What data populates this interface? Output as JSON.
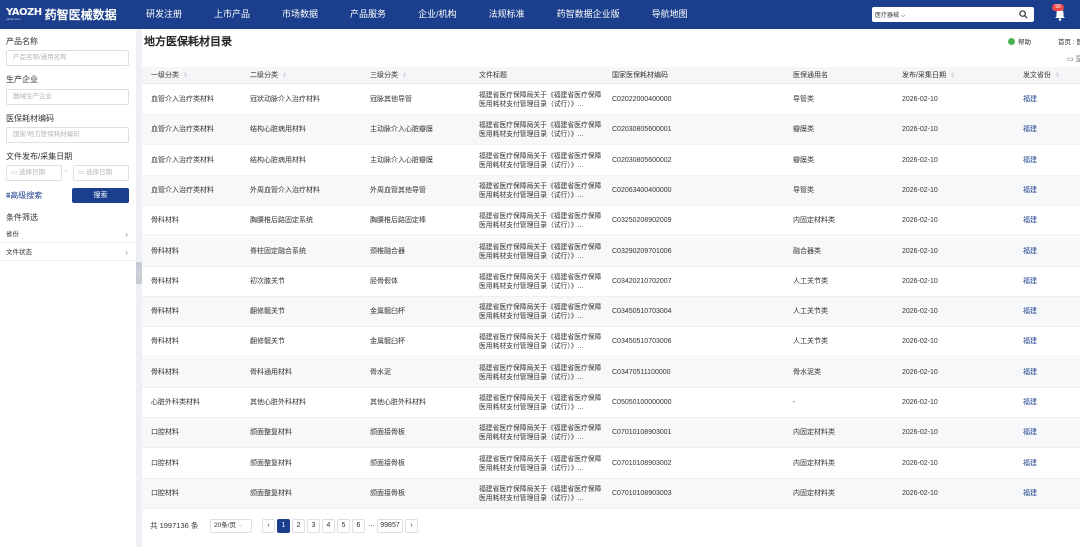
{
  "brand": {
    "logo_mark": "YAOZH",
    "logo_sub": "yaozh.com",
    "name": "药智医械数据"
  },
  "nav": [
    "研发注册",
    "上市产品",
    "市场数据",
    "产品服务",
    "企业/机构",
    "法规标准",
    "药智数据企业版",
    "导航地图"
  ],
  "top_search": {
    "selected": "医疗器械",
    "badge": "99"
  },
  "sidebar": {
    "product_name_label": "产品名称",
    "product_name_placeholder": "产品名称/通用名称",
    "company_label": "生产企业",
    "company_placeholder": "器械生产企业",
    "code_label": "医保耗材编码",
    "code_placeholder": "国家/地方医保耗材编码",
    "date_label": "文件发布/采集日期",
    "date_start_placeholder": "选择日期",
    "date_sep": "-",
    "date_end_placeholder": "选择日期",
    "advanced_search": "高级搜索",
    "search_button": "搜索",
    "filter_title": "条件筛选",
    "filters": [
      "省份",
      "文件状态"
    ]
  },
  "page": {
    "title": "地方医保耗材目录",
    "help": "帮助",
    "breadcrumb": "首页 : 医"
  },
  "table": {
    "columns": [
      "一级分类",
      "二级分类",
      "三级分类",
      "文件标题",
      "国家医保耗材编码",
      "医保通用名",
      "发布/采集日期",
      "发文省份"
    ],
    "rows": [
      {
        "c1": "血管介入治疗类材料",
        "c2": "冠状动脉介入治疗材料",
        "c3": "冠脉其他导管",
        "title": "福建省医疗保障局关于《福建省医疗保障医用耗材支付管理目录（试行）》...",
        "code": "C02022000400000",
        "generic": "导管类",
        "date": "2026-02-10",
        "prov": "福建"
      },
      {
        "c1": "血管介入治疗类材料",
        "c2": "结构心脏病用材料",
        "c3": "主动脉介入心脏瓣膜",
        "title": "福建省医疗保障局关于《福建省医疗保障医用耗材支付管理目录（试行）》...",
        "code": "C02030805600001",
        "generic": "瓣膜类",
        "date": "2026-02-10",
        "prov": "福建"
      },
      {
        "c1": "血管介入治疗类材料",
        "c2": "结构心脏病用材料",
        "c3": "主动脉介入心脏瓣膜",
        "title": "福建省医疗保障局关于《福建省医疗保障医用耗材支付管理目录（试行）》...",
        "code": "C02030805600002",
        "generic": "瓣膜类",
        "date": "2026-02-10",
        "prov": "福建"
      },
      {
        "c1": "血管介入治疗类材料",
        "c2": "外周血管介入治疗材料",
        "c3": "外周血管其他导管",
        "title": "福建省医疗保障局关于《福建省医疗保障医用耗材支付管理目录（试行）》...",
        "code": "C02063400400000",
        "generic": "导管类",
        "date": "2026-02-10",
        "prov": "福建"
      },
      {
        "c1": "骨科材料",
        "c2": "胸腰椎后路固定系统",
        "c3": "胸腰椎后路固定棒",
        "title": "福建省医疗保障局关于《福建省医疗保障医用耗材支付管理目录（试行）》...",
        "code": "C03250208902009",
        "generic": "内固定材料类",
        "date": "2026-02-10",
        "prov": "福建"
      },
      {
        "c1": "骨科材料",
        "c2": "脊柱固定融合系统",
        "c3": "颈椎融合器",
        "title": "福建省医疗保障局关于《福建省医疗保障医用耗材支付管理目录（试行）》...",
        "code": "C03290209701006",
        "generic": "融合器类",
        "date": "2026-02-10",
        "prov": "福建"
      },
      {
        "c1": "骨科材料",
        "c2": "初次膝关节",
        "c3": "胫骨假体",
        "title": "福建省医疗保障局关于《福建省医疗保障医用耗材支付管理目录（试行）》...",
        "code": "C03420210702007",
        "generic": "人工关节类",
        "date": "2026-02-10",
        "prov": "福建"
      },
      {
        "c1": "骨科材料",
        "c2": "翻修髋关节",
        "c3": "金属髋臼杯",
        "title": "福建省医疗保障局关于《福建省医疗保障医用耗材支付管理目录（试行）》...",
        "code": "C03450510703004",
        "generic": "人工关节类",
        "date": "2026-02-10",
        "prov": "福建"
      },
      {
        "c1": "骨科材料",
        "c2": "翻修髋关节",
        "c3": "金属髋臼杯",
        "title": "福建省医疗保障局关于《福建省医疗保障医用耗材支付管理目录（试行）》...",
        "code": "C03450510703006",
        "generic": "人工关节类",
        "date": "2026-02-10",
        "prov": "福建"
      },
      {
        "c1": "骨科材料",
        "c2": "骨科通用材料",
        "c3": "骨水泥",
        "title": "福建省医疗保障局关于《福建省医疗保障医用耗材支付管理目录（试行）》...",
        "code": "C03470511100000",
        "generic": "骨水泥类",
        "date": "2026-02-10",
        "prov": "福建"
      },
      {
        "c1": "心脏外科类材料",
        "c2": "其他心脏外科材料",
        "c3": "其他心脏外科材料",
        "title": "福建省医疗保障局关于《福建省医疗保障医用耗材支付管理目录（试行）》...",
        "code": "C05050100000000",
        "generic": "-",
        "date": "2026-02-10",
        "prov": "福建"
      },
      {
        "c1": "口腔材料",
        "c2": "颌面整复材料",
        "c3": "颌面接骨板",
        "title": "福建省医疗保障局关于《福建省医疗保障医用耗材支付管理目录（试行）》...",
        "code": "C07010108903001",
        "generic": "内固定材料类",
        "date": "2026-02-10",
        "prov": "福建"
      },
      {
        "c1": "口腔材料",
        "c2": "颌面整复材料",
        "c3": "颌面接骨板",
        "title": "福建省医疗保障局关于《福建省医疗保障医用耗材支付管理目录（试行）》...",
        "code": "C07010108903002",
        "generic": "内固定材料类",
        "date": "2026-02-10",
        "prov": "福建"
      },
      {
        "c1": "口腔材料",
        "c2": "颌面整复材料",
        "c3": "颌面接骨板",
        "title": "福建省医疗保障局关于《福建省医疗保障医用耗材支付管理目录（试行）》...",
        "code": "C07010108903003",
        "generic": "内固定材料类",
        "date": "2026-02-10",
        "prov": "福建"
      }
    ]
  },
  "pagination": {
    "total": "共 1997136 条",
    "page_size": "20条/页",
    "prev": "‹",
    "pages": [
      "1",
      "2",
      "3",
      "4",
      "5",
      "6",
      "...",
      "99857"
    ],
    "next": "›"
  }
}
